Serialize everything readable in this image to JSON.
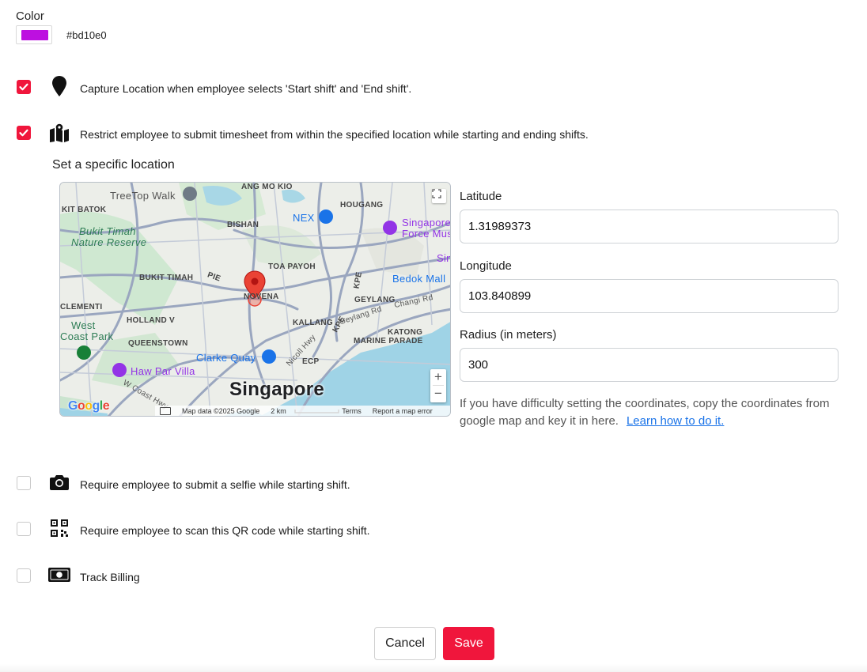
{
  "color": {
    "label": "Color",
    "value": "#bd10e0"
  },
  "options": [
    {
      "checked": true,
      "icon": "map-pin-icon",
      "label": "Capture Location when employee selects 'Start shift' and 'End shift'."
    },
    {
      "checked": true,
      "icon": "map-icon",
      "label": "Restrict employee to submit timesheet from within the specified location while starting and ending shifts."
    },
    {
      "checked": false,
      "icon": "camera-icon",
      "label": "Require employee to submit a selfie while starting shift."
    },
    {
      "checked": false,
      "icon": "qr-code-icon",
      "label": "Require employee to scan this QR code while starting shift."
    },
    {
      "checked": false,
      "icon": "money-icon",
      "label": "Track Billing"
    }
  ],
  "location": {
    "title": "Set a specific location",
    "latitude_label": "Latitude",
    "latitude": "1.31989373",
    "longitude_label": "Longitude",
    "longitude": "103.840899",
    "radius_label": "Radius (in meters)",
    "radius": "300",
    "help_text": "If you have difficulty setting the coordinates, copy the coordinates from google map and key it in here.",
    "help_link": "Learn how to do it."
  },
  "map": {
    "city": "Singapore",
    "places": {
      "treetop": "TreeTop Walk",
      "ang_mo_kio": "ANG MO KIO",
      "hougang": "HOUGANG",
      "kit_batok": "KIT BATOK",
      "bukit_timah_reserve_1": "Bukit Timah",
      "bukit_timah_reserve_2": "Nature Reserve",
      "bishan": "BISHAN",
      "nex": "NEX",
      "sg_force_1": "Singapore",
      "sg_force_2": "Force Mus",
      "sin": "Sin",
      "toa_payoh": "TOA PAYOH",
      "bukit_timah": "BUKIT TIMAH",
      "pie": "PIE",
      "kpe": "KPE",
      "bedok_mall": "Bedok Mall",
      "clementi": "CLEMENTI",
      "novena": "NOVENA",
      "geylang": "GEYLANG",
      "changi_rd": "Changi Rd",
      "west_coast_1": "West",
      "west_coast_2": "Coast Park",
      "holland_v": "HOLLAND V",
      "kallang": "KALLANG",
      "geylang_rd": "Geylang Rd",
      "kpe2": "KPE",
      "katong": "KATONG",
      "queenstown": "QUEENSTOWN",
      "marine_parade": "MARINE PARADE",
      "clarke_quay": "Clarke Quay",
      "nicoll_hwy": "Nicoll Hwy",
      "ecp": "ECP",
      "haw_par": "Haw Par Villa",
      "w_coast_hwy": "W Coast Hwy"
    },
    "zoom_in": "+",
    "zoom_out": "−",
    "google": "Google",
    "map_data": "Map data ©2025 Google",
    "scale": "2 km",
    "terms": "Terms",
    "report": "Report a map error"
  },
  "buttons": {
    "cancel": "Cancel",
    "save": "Save"
  },
  "colors": {
    "accent": "#f0163c",
    "link": "#1a73e8",
    "pin": "#ea4335"
  }
}
